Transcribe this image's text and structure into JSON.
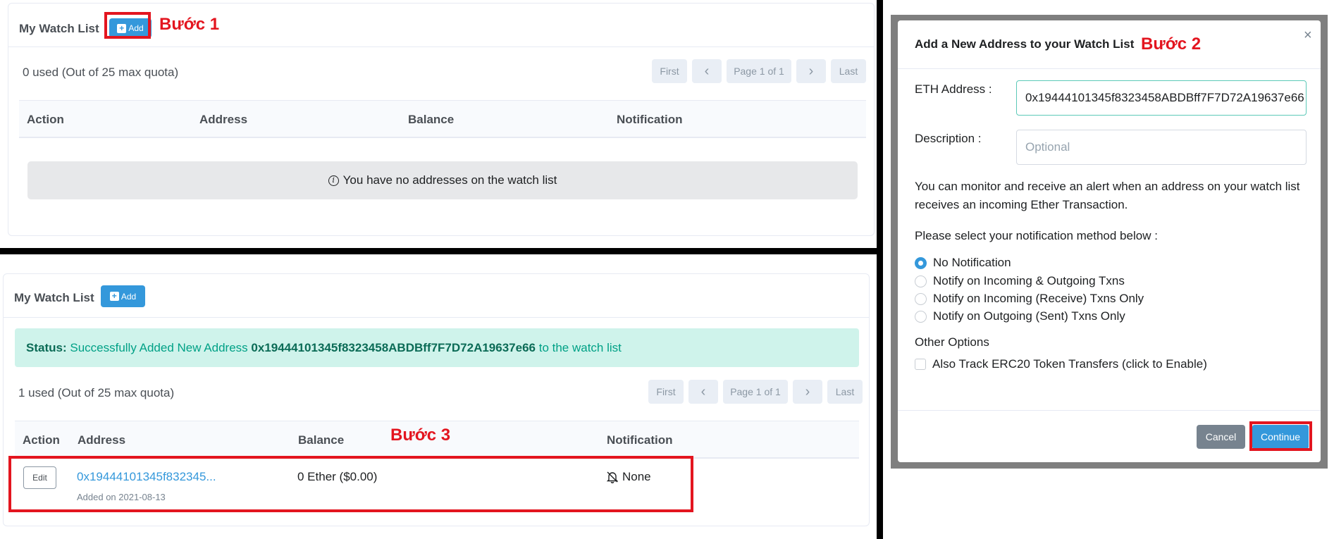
{
  "top_panel": {
    "title": "My Watch List",
    "add_label": "Add",
    "step_label": "Bước 1",
    "quota_text": "0 used (Out of 25 max quota)",
    "pager": {
      "first": "First",
      "prev": "‹",
      "page": "Page 1 of 1",
      "next": "›",
      "last": "Last"
    },
    "columns": [
      "Action",
      "Address",
      "Balance",
      "Notification"
    ],
    "empty_message": "You have no addresses on the watch list"
  },
  "bottom_panel": {
    "title": "My Watch List",
    "add_label": "Add",
    "status_label": "Status:",
    "status_message": "Successfully Added New Address",
    "status_address": "0x19444101345f8323458ABDBff7F7D72A19637e66",
    "status_suffix": "to the watch list",
    "quota_text": "1 used (Out of 25 max quota)",
    "pager": {
      "first": "First",
      "prev": "‹",
      "page": "Page 1 of 1",
      "next": "›",
      "last": "Last"
    },
    "columns": [
      "Action",
      "Address",
      "Balance",
      "Notification"
    ],
    "step_label": "Bước 3",
    "row": {
      "edit_label": "Edit",
      "address": "0x19444101345f832345...",
      "added_on": "Added on 2021-08-13",
      "balance": "0 Ether ($0.00)",
      "notification": "None"
    }
  },
  "modal": {
    "title": "Add a New Address to your Watch List",
    "step_label": "Bước 2",
    "close": "×",
    "eth_label": "ETH Address :",
    "eth_value": "0x19444101345f8323458ABDBff7F7D72A19637e66",
    "desc_label": "Description :",
    "desc_placeholder": "Optional",
    "info_text": "You can monitor and receive an alert when an address on your watch list receives an incoming Ether Transaction.",
    "select_prompt": "Please select your notification method below :",
    "options": [
      {
        "label": "No Notification",
        "selected": true
      },
      {
        "label": "Notify on Incoming & Outgoing Txns",
        "selected": false
      },
      {
        "label": "Notify on Incoming (Receive) Txns Only",
        "selected": false
      },
      {
        "label": "Notify on Outgoing (Sent) Txns Only",
        "selected": false
      }
    ],
    "other_options_label": "Other Options",
    "erc20_label": "Also Track ERC20 Token Transfers (click to Enable)",
    "cancel_label": "Cancel",
    "continue_label": "Continue"
  },
  "colors": {
    "accent": "#3498db",
    "annotation_red": "#e3151f",
    "status_bg": "#cff3eb",
    "status_text": "#00a186"
  },
  "icons": [
    "plus-icon",
    "info-icon",
    "bell-slash-icon",
    "close-icon",
    "chevron-left-icon",
    "chevron-right-icon"
  ]
}
